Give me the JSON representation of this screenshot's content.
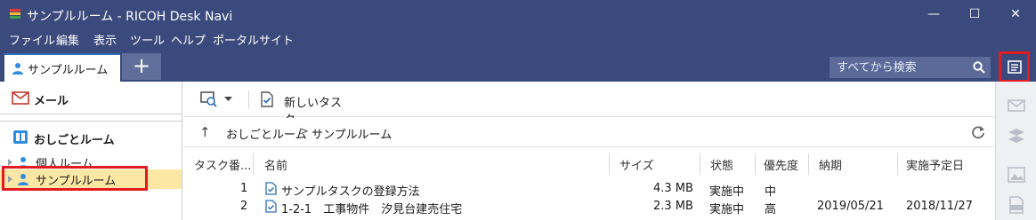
{
  "window": {
    "title": "サンプルルーム - RICOH Desk Navi",
    "minimize_glyph": "—",
    "maximize_glyph": "☐",
    "close_glyph": "✕"
  },
  "menu": [
    "ファイル",
    "編集",
    "表示",
    "ツール",
    "ヘルプ",
    "ポータルサイト"
  ],
  "tabs": {
    "active_label": "サンプルルーム",
    "add_glyph": "+"
  },
  "search": {
    "placeholder": "すべてから検索"
  },
  "sidebar": {
    "mail_label": "メール",
    "work_label": "おしごとルーム",
    "rooms": [
      "個人ルーム",
      "サンプルルーム"
    ],
    "selected_room": "サンプルルーム"
  },
  "toolbar": {
    "new_task_label": "新しいタスク"
  },
  "breadcrumb": {
    "up_glyph": "↑",
    "root": "おしごとルーム",
    "separator": ">",
    "current": "サンプルルーム"
  },
  "table": {
    "columns": [
      "タスク番...",
      "名前",
      "サイズ",
      "状態",
      "優先度",
      "納期",
      "実施予定日"
    ],
    "rows": [
      {
        "no": "1",
        "name": "サンプルタスクの登録方法",
        "size": "4.3 MB",
        "status": "実施中",
        "priority": "中",
        "due": "",
        "scheduled": ""
      },
      {
        "no": "2",
        "name": "1-2-1　工事物件　汐見台建売住宅",
        "size": "2.3 MB",
        "status": "実施中",
        "priority": "高",
        "due": "2019/05/21",
        "scheduled": "2018/11/27"
      }
    ]
  },
  "colors": {
    "header_bg": "#3b4a7c",
    "selection_bg": "#fde7a4",
    "highlight_border": "#e11b22",
    "user_icon": "#2f8de0"
  },
  "icons": {
    "panel_toggle": "panel-toggle-icon",
    "rail": [
      "rail-mail-icon",
      "rail-layers-icon",
      "rail-image-icon",
      "rail-pdf-icon"
    ]
  }
}
